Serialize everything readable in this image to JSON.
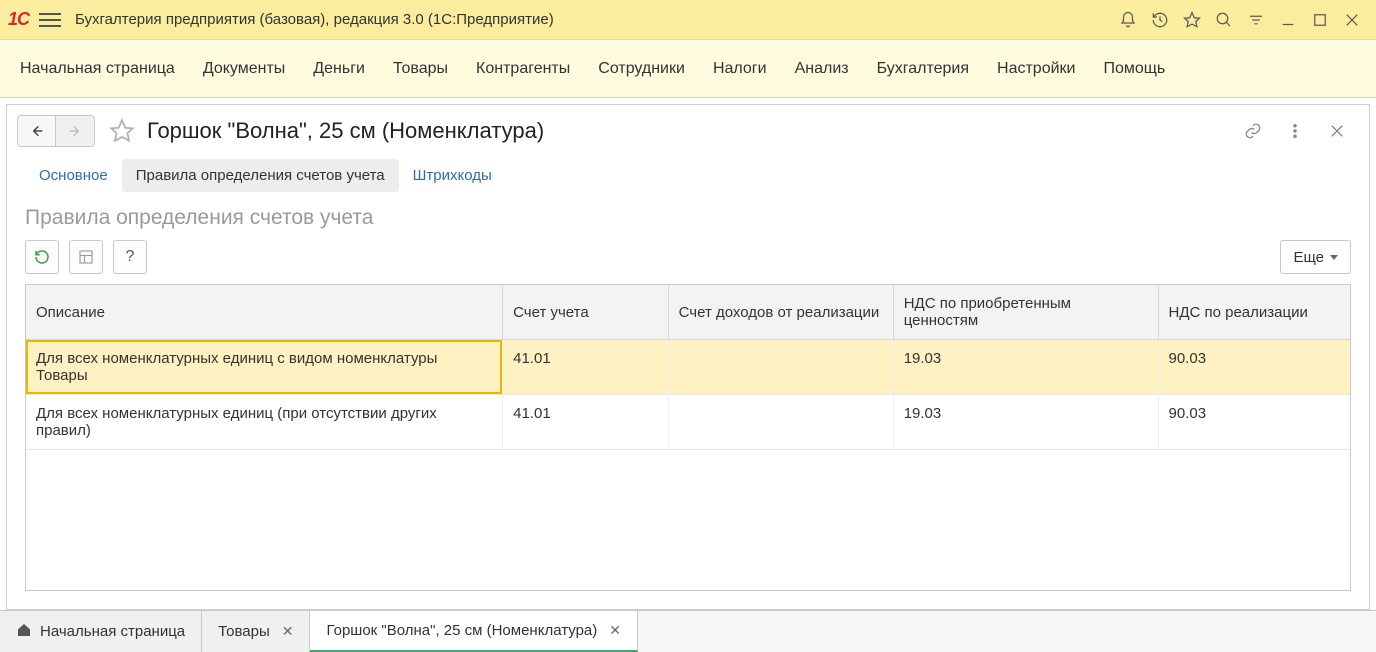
{
  "app": {
    "title": "Бухгалтерия предприятия (базовая), редакция 3.0  (1С:Предприятие)",
    "logo": "1C"
  },
  "main_menu": [
    "Начальная страница",
    "Документы",
    "Деньги",
    "Товары",
    "Контрагенты",
    "Сотрудники",
    "Налоги",
    "Анализ",
    "Бухгалтерия",
    "Настройки",
    "Помощь"
  ],
  "page": {
    "title": "Горшок \"Волна\", 25 см (Номенклатура)",
    "tabs": [
      {
        "label": "Основное",
        "active": false
      },
      {
        "label": "Правила определения счетов учета",
        "active": true
      },
      {
        "label": "Штрихкоды",
        "active": false
      }
    ],
    "subheading": "Правила определения счетов учета",
    "more_label": "Еще"
  },
  "table": {
    "columns": [
      "Описание",
      "Счет учета",
      "Счет доходов от реализации",
      "НДС по приобретенным ценностям",
      "НДС по реализации"
    ],
    "rows": [
      {
        "selected": true,
        "cells": [
          "Для всех номенклатурных единиц с видом номенклатуры Товары",
          "41.01",
          "",
          "19.03",
          "90.03"
        ]
      },
      {
        "selected": false,
        "cells": [
          "Для всех номенклатурных единиц (при отсутствии других правил)",
          "41.01",
          "",
          "19.03",
          "90.03"
        ]
      }
    ]
  },
  "bottom_tabs": [
    {
      "label": "Начальная страница",
      "home": true,
      "closeable": false,
      "active": false
    },
    {
      "label": "Товары",
      "closeable": true,
      "active": false
    },
    {
      "label": "Горшок \"Волна\", 25 см (Номенклатура)",
      "closeable": true,
      "active": true
    }
  ]
}
